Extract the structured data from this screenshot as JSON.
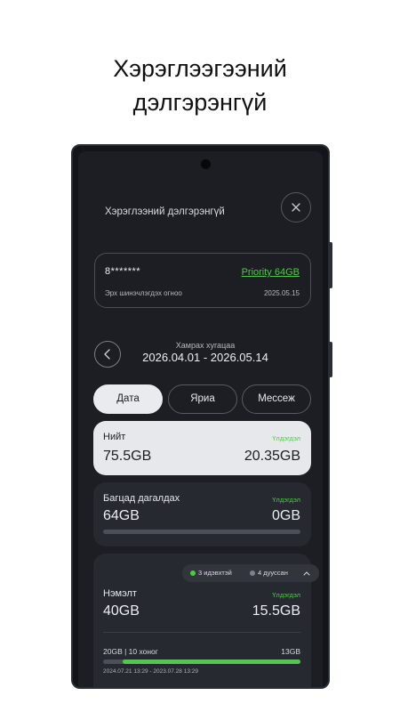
{
  "headline": {
    "line1": "Хэрэглээгээний",
    "line2": "дэлгэрэнгүй"
  },
  "screen": {
    "title": "Хэрэглээний дэлгэрэнгүй"
  },
  "account": {
    "number": "8*******",
    "plan": "Priority 64GB",
    "renew_label": "Эрх шинэчлэгдэх огноо",
    "renew_date": "2025.05.15"
  },
  "period": {
    "label": "Хамрах хугацаа",
    "value": "2026.04.01 - 2026.05.14"
  },
  "tabs": [
    {
      "label": "Дата",
      "active": true
    },
    {
      "label": "Яриа",
      "active": false
    },
    {
      "label": "Мессеж",
      "active": false
    }
  ],
  "total": {
    "label": "Нийт",
    "remaining_label": "Үлдэгдэл",
    "amount": "75.5GB",
    "remaining": "20.35GB"
  },
  "package": {
    "label": "Багцад дагалдах",
    "remaining_label": "Үлдэгдэл",
    "amount": "64GB",
    "remaining": "0GB",
    "used_fraction": 1.0
  },
  "extra": {
    "chip_active": "3 идэвхтэй",
    "chip_expired": "4 дууссан",
    "label": "Нэмэлт",
    "remaining_label": "Үлдэгдэл",
    "amount": "40GB",
    "remaining": "15.5GB",
    "item": {
      "title": "20GB | 10 хоног",
      "remaining": "13GB",
      "dates": "2024.07.21 13:29 - 2023.07.28 13:29",
      "remaining_fraction": 0.9
    }
  },
  "colors": {
    "accent": "#4ccb45",
    "background": "#1c1e24",
    "card": "#262930",
    "card_light": "#e6e8ec"
  }
}
